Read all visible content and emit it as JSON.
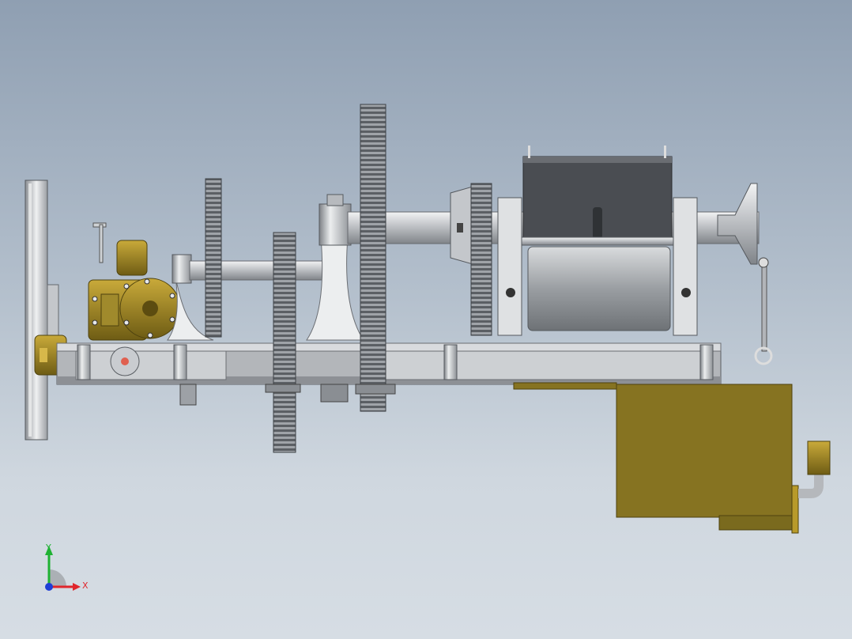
{
  "viewport": {
    "background_top": "#8f9fb2",
    "background_bottom": "#d6dde4"
  },
  "model": {
    "part_colors": {
      "steel": "#c9ccd0",
      "dark_steel": "#5a5e63",
      "brass": "#8a7420",
      "brass_light": "#b89a2a",
      "hopper": "#4a4d52",
      "tank": "#867321"
    }
  },
  "triad": {
    "x_label": "X",
    "y_label": "Y",
    "x_color": "#e0262c",
    "y_color": "#1fb233",
    "z_color": "#1f3fd6"
  }
}
